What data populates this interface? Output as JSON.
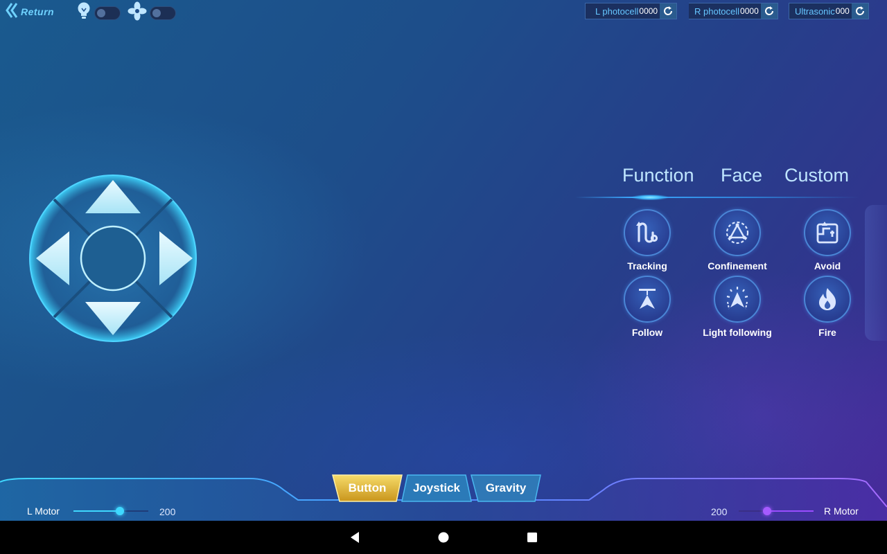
{
  "topbar": {
    "return_label": "Return",
    "light_toggle": {
      "icon": "lightbulb-icon",
      "on": false
    },
    "fan_toggle": {
      "icon": "fan-icon",
      "on": false
    },
    "sensors": [
      {
        "label": "L photocell",
        "value": "0000",
        "icon": "refresh-icon"
      },
      {
        "label": "R photocell",
        "value": "0000",
        "icon": "refresh-icon"
      },
      {
        "label": "Ultrasonic",
        "value": "000",
        "icon": "refresh-icon"
      }
    ]
  },
  "dpad": {
    "up": "arrow-up-icon",
    "down": "arrow-down-icon",
    "left": "arrow-left-icon",
    "right": "arrow-right-icon"
  },
  "panel": {
    "tabs": [
      {
        "label": "Function",
        "active": true
      },
      {
        "label": "Face",
        "active": false
      },
      {
        "label": "Custom",
        "active": false
      }
    ],
    "functions": [
      {
        "label": "Tracking",
        "icon": "tracking-icon"
      },
      {
        "label": "Confinement",
        "icon": "confinement-icon"
      },
      {
        "label": "Avoid",
        "icon": "avoid-icon"
      },
      {
        "label": "Follow",
        "icon": "follow-icon"
      },
      {
        "label": "Light following",
        "icon": "light-following-icon"
      },
      {
        "label": "Fire",
        "icon": "fire-icon"
      }
    ]
  },
  "bottom": {
    "mode_tabs": [
      {
        "label": "Button",
        "active": true
      },
      {
        "label": "Joystick",
        "active": false
      },
      {
        "label": "Gravity",
        "active": false
      }
    ],
    "left_motor": {
      "label": "L Motor",
      "value": "200",
      "level": 0.62
    },
    "right_motor": {
      "label": "R Motor",
      "value": "200",
      "level": 0.38
    }
  },
  "colors": {
    "accent_cyan": "#3fd8ff",
    "accent_purple": "#9a4dff",
    "active_tab_gold": "#e9bf3c",
    "label_blue": "#66c6ff"
  }
}
